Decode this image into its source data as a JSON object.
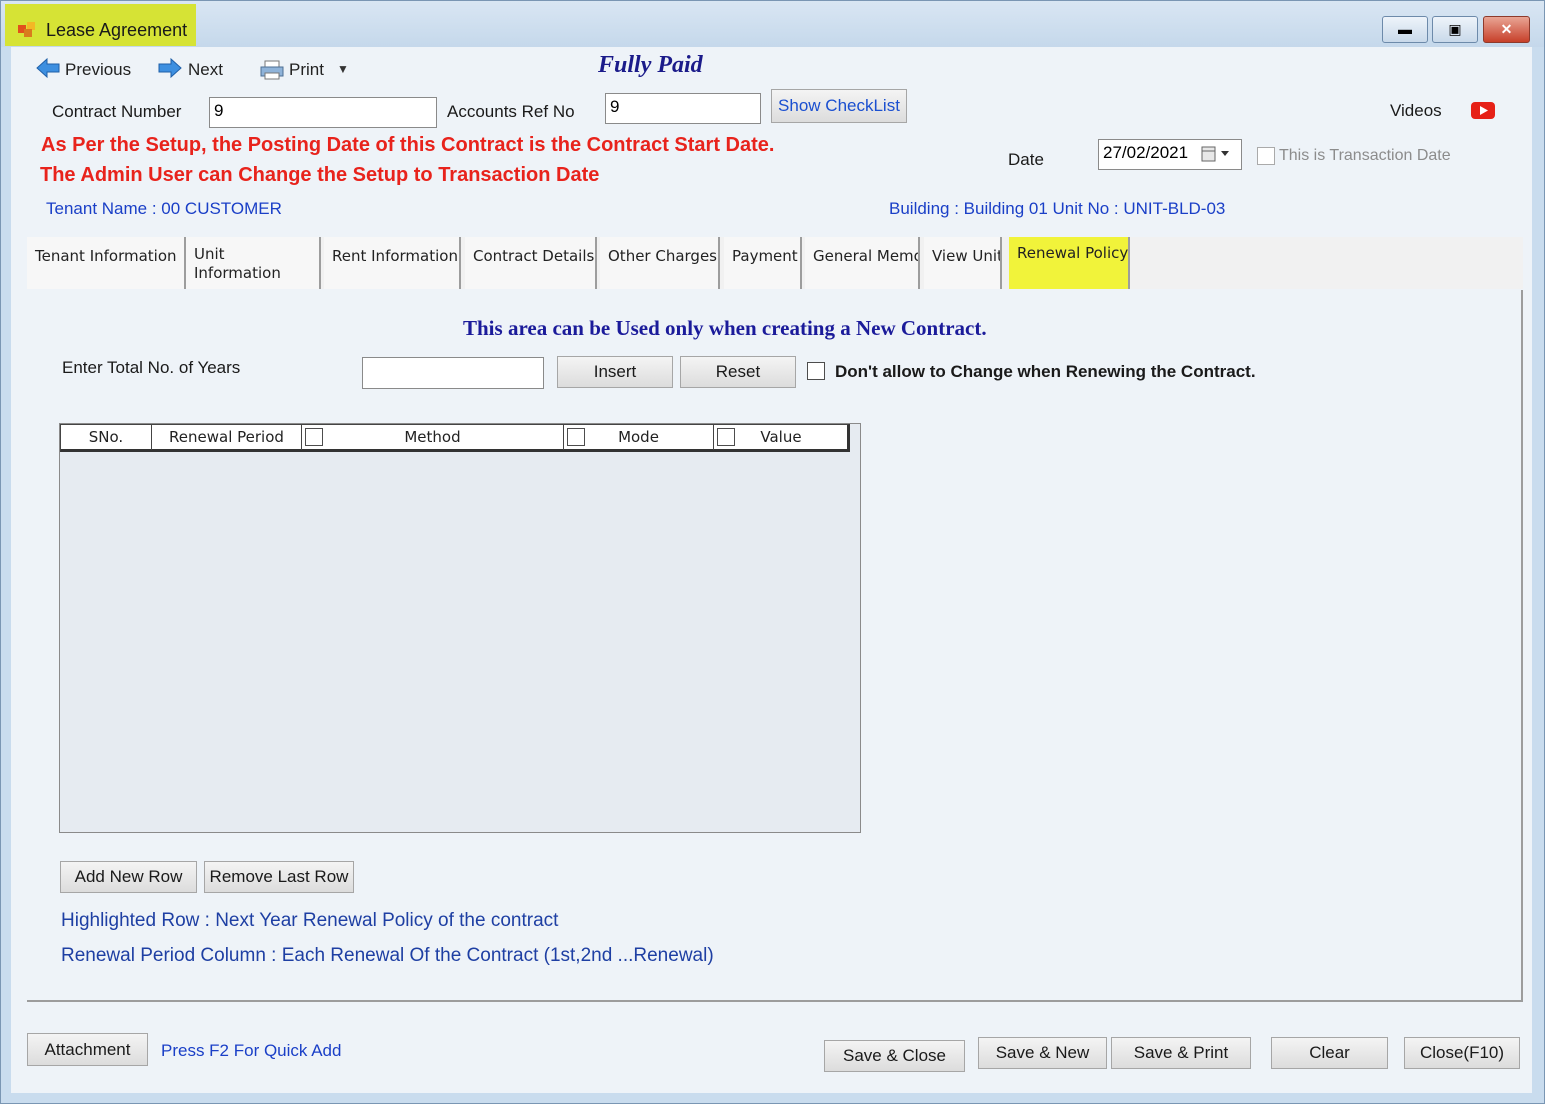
{
  "window": {
    "title": "Lease Agreement"
  },
  "toolbar": {
    "previous_label": "Previous",
    "next_label": "Next",
    "print_label": "Print",
    "status_text": "Fully Paid"
  },
  "header": {
    "contract_number_label": "Contract Number",
    "contract_number_value": "9",
    "accounts_ref_label": "Accounts Ref No",
    "accounts_ref_value": "9",
    "show_checklist_label": "Show CheckList",
    "videos_label": "Videos",
    "warning_line1": "As Per the Setup, the Posting Date of this Contract is the Contract Start Date.",
    "warning_line2": "The Admin User can Change the Setup to Transaction Date",
    "date_label": "Date",
    "date_value": "27/02/2021",
    "transaction_date_label": "This is Transaction Date",
    "tenant_name": "Tenant Name : 00 CUSTOMER",
    "building_unit": "Building : Building 01  Unit No : UNIT-BLD-03"
  },
  "tabs": [
    {
      "label": "Tenant Information"
    },
    {
      "label": "Unit Information"
    },
    {
      "label": "Rent Information"
    },
    {
      "label": "Contract Details"
    },
    {
      "label": "Other Charges"
    },
    {
      "label": "Payment"
    },
    {
      "label": "General Memo"
    },
    {
      "label": "View Unit"
    },
    {
      "label": "Renewal Policy"
    }
  ],
  "renewal": {
    "notice": "This area can be Used only when creating a New Contract.",
    "years_label": "Enter Total No. of Years",
    "years_value": "",
    "insert_label": "Insert",
    "reset_label": "Reset",
    "dont_allow_label": "Don't allow to Change when Renewing the Contract.",
    "columns": [
      "SNo.",
      "Renewal Period",
      "Method",
      "Mode",
      "Value"
    ],
    "add_row_label": "Add New Row",
    "remove_row_label": "Remove Last Row",
    "info_line1": "Highlighted Row : Next Year Renewal Policy of the contract",
    "info_line2": "Renewal Period Column : Each Renewal Of the Contract (1st,2nd ...Renewal)"
  },
  "footer": {
    "attachment_label": "Attachment",
    "quick_add_hint": "Press F2 For Quick Add",
    "save_close_label": "Save & Close",
    "save_new_label": "Save & New",
    "save_print_label": "Save & Print",
    "clear_label": "Clear",
    "close_label": "Close(F10)"
  },
  "colors": {
    "warning": "#e8231c",
    "link_blue": "#1a3fc7",
    "active_tab": "#f1f33a",
    "title_highlight": "#d6e335"
  },
  "icons": [
    "app-icon",
    "arrow-left-icon",
    "arrow-right-icon",
    "printer-icon",
    "dropdown-arrow-icon",
    "youtube-icon",
    "calendar-icon",
    "minimize-icon",
    "maximize-icon",
    "close-icon"
  ]
}
